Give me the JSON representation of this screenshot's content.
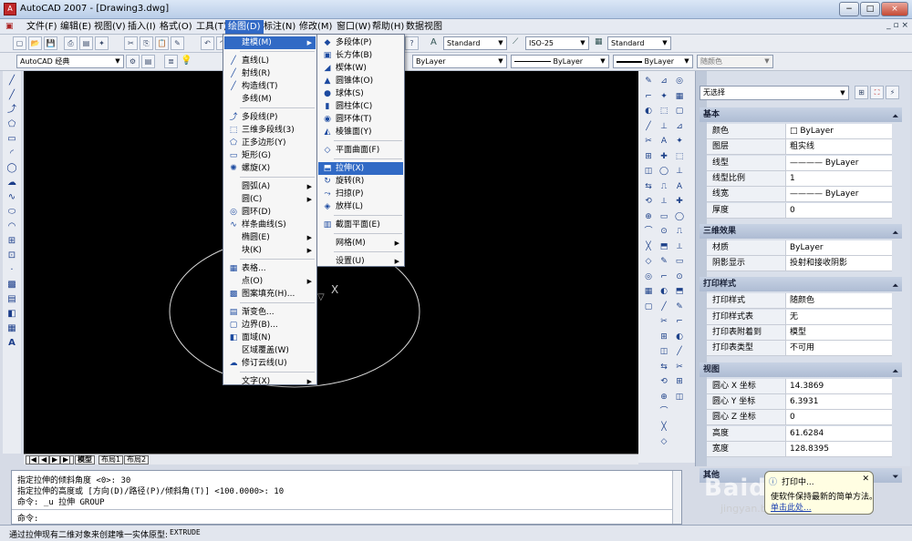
{
  "window": {
    "title": "AutoCAD 2007 - [Drawing3.dwg]",
    "app_icon": "A"
  },
  "window_buttons": [
    "−",
    "□",
    "×"
  ],
  "mdi_buttons": "_ ▫ ×",
  "menubar": [
    {
      "label": "文件(F)"
    },
    {
      "label": "编辑(E)"
    },
    {
      "label": "视图(V)"
    },
    {
      "label": "插入(I)"
    },
    {
      "label": "格式(O)"
    },
    {
      "label": "工具(T)"
    },
    {
      "label": "绘图(D)",
      "active": true
    },
    {
      "label": "标注(N)"
    },
    {
      "label": "修改(M)"
    },
    {
      "label": "窗口(W)"
    },
    {
      "label": "帮助(H)"
    },
    {
      "label": "数据视图"
    }
  ],
  "toolbar1": {
    "text_style": "Standard",
    "dim_style": "ISO-25",
    "table_style": "Standard"
  },
  "toolbar2": {
    "workspace": "AutoCAD 经典",
    "layer_color": "ByLayer",
    "linetype": "ByLayer",
    "lineweight": "ByLayer",
    "plotstyle": "随颜色"
  },
  "draw_menu": [
    {
      "icon": "",
      "label": "建模(M)",
      "sub": true,
      "hl": true
    },
    {
      "sep": true
    },
    {
      "icon": "╱",
      "label": "直线(L)"
    },
    {
      "icon": "╱",
      "label": "射线(R)"
    },
    {
      "icon": "╱",
      "label": "构造线(T)"
    },
    {
      "icon": "",
      "label": "多线(M)"
    },
    {
      "sep": true
    },
    {
      "icon": "⤴",
      "label": "多段线(P)"
    },
    {
      "icon": "⬚",
      "label": "三维多段线(3)"
    },
    {
      "icon": "⬠",
      "label": "正多边形(Y)"
    },
    {
      "icon": "▭",
      "label": "矩形(G)"
    },
    {
      "icon": "✺",
      "label": "螺旋(X)"
    },
    {
      "sep": true
    },
    {
      "icon": "",
      "label": "圆弧(A)",
      "sub": true
    },
    {
      "icon": "",
      "label": "圆(C)",
      "sub": true
    },
    {
      "icon": "◎",
      "label": "圆环(D)"
    },
    {
      "icon": "∿",
      "label": "样条曲线(S)"
    },
    {
      "icon": "",
      "label": "椭圆(E)",
      "sub": true
    },
    {
      "icon": "",
      "label": "块(K)",
      "sub": true
    },
    {
      "sep": true
    },
    {
      "icon": "▦",
      "label": "表格..."
    },
    {
      "icon": "",
      "label": "点(O)",
      "sub": true
    },
    {
      "icon": "▩",
      "label": "图案填充(H)..."
    },
    {
      "sep": true
    },
    {
      "icon": "▤",
      "label": "渐变色..."
    },
    {
      "icon": "▢",
      "label": "边界(B)..."
    },
    {
      "icon": "◧",
      "label": "面域(N)"
    },
    {
      "icon": "",
      "label": "区域覆盖(W)"
    },
    {
      "icon": "☁",
      "label": "修订云线(U)"
    },
    {
      "sep": true
    },
    {
      "icon": "",
      "label": "文字(X)",
      "sub": true
    }
  ],
  "modeling_menu": [
    {
      "icon": "◆",
      "label": "多段体(P)"
    },
    {
      "icon": "▣",
      "label": "长方体(B)"
    },
    {
      "icon": "◢",
      "label": "楔体(W)"
    },
    {
      "icon": "▲",
      "label": "圆锥体(O)"
    },
    {
      "icon": "●",
      "label": "球体(S)"
    },
    {
      "icon": "▮",
      "label": "圆柱体(C)"
    },
    {
      "icon": "◉",
      "label": "圆环体(T)"
    },
    {
      "icon": "◭",
      "label": "棱锥面(Y)"
    },
    {
      "sep": true
    },
    {
      "icon": "◇",
      "label": "平面曲面(F)"
    },
    {
      "sep": true
    },
    {
      "icon": "⬒",
      "label": "拉伸(X)",
      "hl": true
    },
    {
      "icon": "↻",
      "label": "旋转(R)"
    },
    {
      "icon": "⤳",
      "label": "扫掠(P)"
    },
    {
      "icon": "◈",
      "label": "放样(L)"
    },
    {
      "sep": true
    },
    {
      "icon": "▥",
      "label": "截面平面(E)"
    },
    {
      "sep": true
    },
    {
      "icon": "",
      "label": "网格(M)",
      "sub": true
    },
    {
      "sep": true
    },
    {
      "icon": "",
      "label": "设置(U)",
      "sub": true
    }
  ],
  "properties": {
    "selection": "无选择",
    "sections": [
      {
        "title": "基本",
        "rows": [
          [
            "颜色",
            "□ ByLayer"
          ],
          [
            "图层",
            "粗实线"
          ],
          [
            "线型",
            "———— ByLayer"
          ],
          [
            "线型比例",
            "1"
          ],
          [
            "线宽",
            "———— ByLayer"
          ],
          [
            "厚度",
            "0"
          ]
        ]
      },
      {
        "title": "三维效果",
        "rows": [
          [
            "材质",
            "ByLayer"
          ],
          [
            "阴影显示",
            "投射和接收阴影"
          ]
        ]
      },
      {
        "title": "打印样式",
        "rows": [
          [
            "打印样式",
            "随颜色"
          ],
          [
            "打印样式表",
            "无"
          ],
          [
            "打印表附着到",
            "模型"
          ],
          [
            "打印表类型",
            "不可用"
          ]
        ]
      },
      {
        "title": "视图",
        "rows": [
          [
            "圆心 X 坐标",
            "14.3869"
          ],
          [
            "圆心 Y 坐标",
            "6.3931"
          ],
          [
            "圆心 Z 坐标",
            "0"
          ],
          [
            "高度",
            "61.6284"
          ],
          [
            "宽度",
            "128.8395"
          ]
        ]
      }
    ],
    "bottom_section": "其他"
  },
  "canvas": {
    "crosshair_label": "X",
    "ucs_marker": "▽"
  },
  "tabs": [
    "模型",
    "布局1",
    "布局2"
  ],
  "tab_nav": [
    "|◀",
    "◀",
    "▶",
    "▶|"
  ],
  "command": {
    "lines": [
      "指定拉伸的倾斜角度 <0>: 30",
      "指定拉伸的高度或 [方向(D)/路径(P)/倾斜角(T)] <100.0000>: 10",
      "命令: _u 拉伸 GROUP"
    ],
    "prompt": "命令:"
  },
  "status": {
    "text": "通过拉伸现有二维对象来创建唯一实体原型:",
    "command_name": "EXTRUDE"
  },
  "tooltip": {
    "title": "打印中...",
    "body": "使软件保持最新的简单方法。",
    "link": "单击此处..."
  },
  "watermark": {
    "text": "Baidu 经验",
    "url": "jingyan.baidu.com"
  },
  "colors": {
    "highlight": "#316AC5",
    "canvas": "#000000",
    "ellipse": "#D8D8D8"
  }
}
